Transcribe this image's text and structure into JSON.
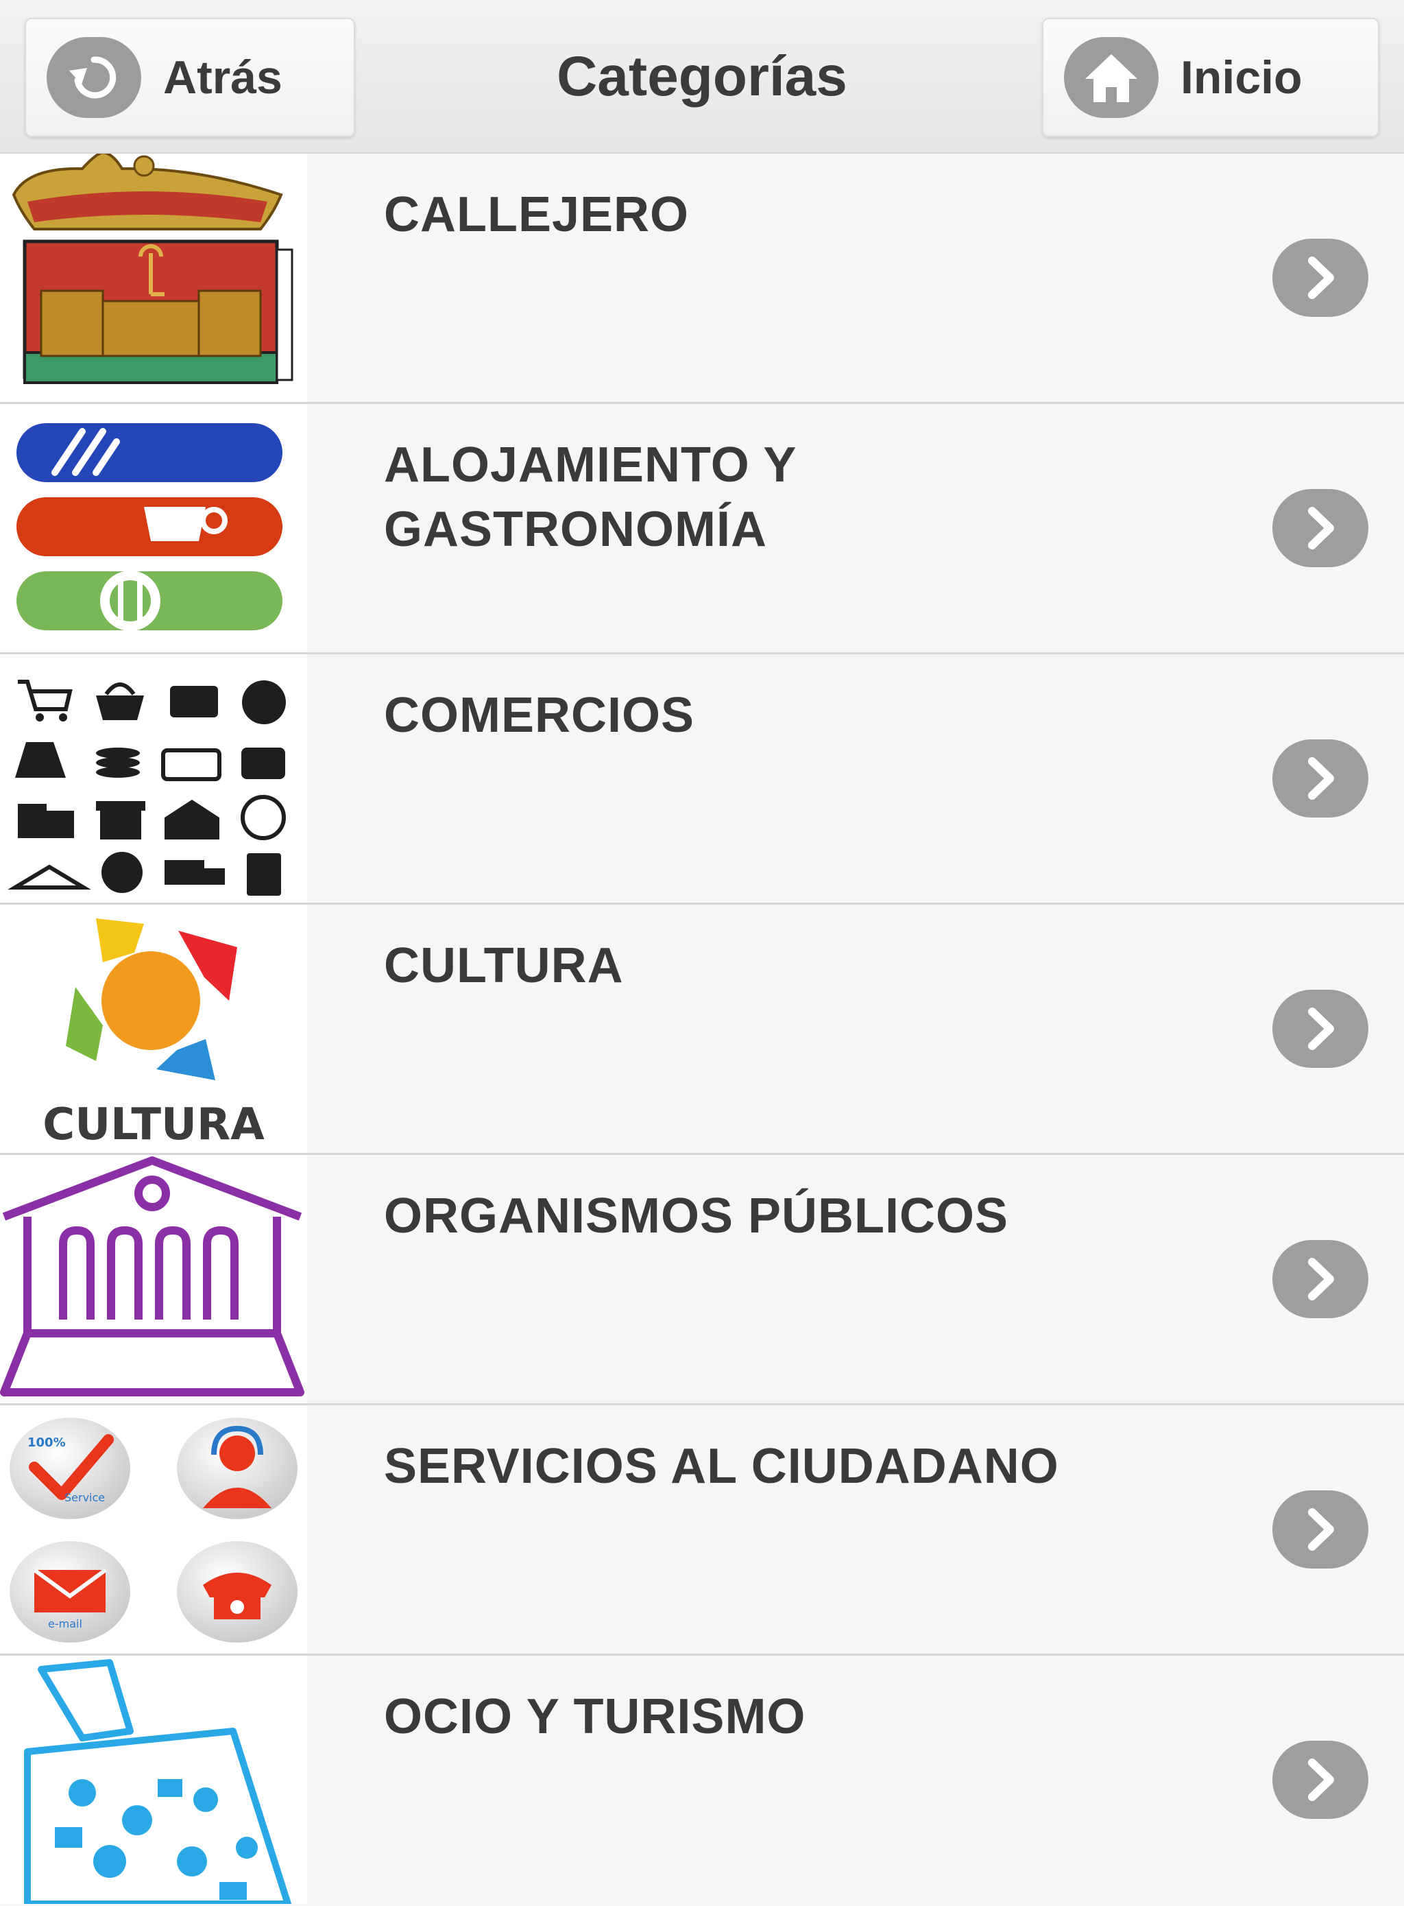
{
  "header": {
    "back_label": "Atrás",
    "title": "Categorías",
    "home_label": "Inicio"
  },
  "categories": [
    {
      "label": "CALLEJERO",
      "icon": "coat-of-arms-icon"
    },
    {
      "label": "ALOJAMIENTO Y GASTRONOMÍA",
      "icon": "dining-bars-icon"
    },
    {
      "label": "COMERCIOS",
      "icon": "shopping-icons-grid"
    },
    {
      "label": "CULTURA",
      "icon": "cultura-logo",
      "icon_text": "CULTURA"
    },
    {
      "label": "ORGANISMOS PÚBLICOS",
      "icon": "public-building-icon"
    },
    {
      "label": "SERVICIOS AL CIUDADANO",
      "icon": "citizen-services-icon",
      "icon_text": [
        "100%",
        "Service",
        "e-mail"
      ]
    },
    {
      "label": "OCIO Y TURISMO",
      "icon": "tourism-suitcase-icon"
    }
  ],
  "colors": {
    "header_bg": "#ececec",
    "row_bg": "#f6f6f6",
    "icon_gray": "#9e9e9e",
    "text": "#3a3a3a"
  }
}
